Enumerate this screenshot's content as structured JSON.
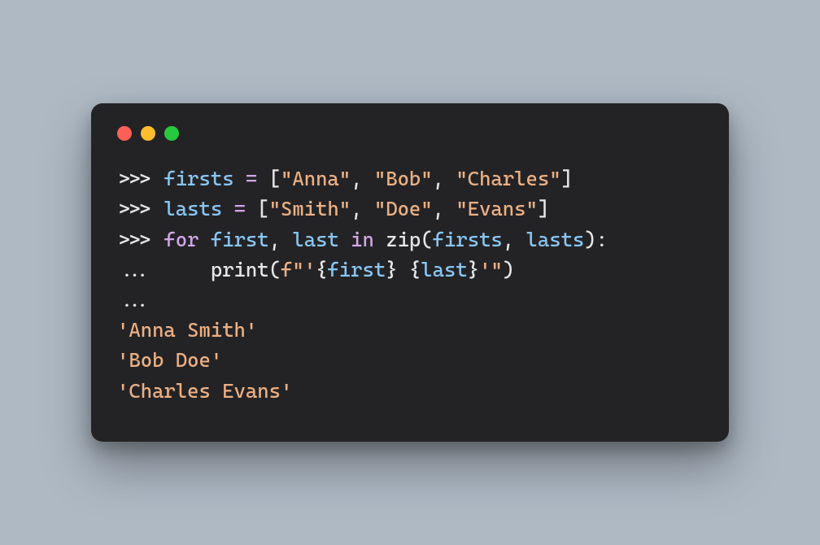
{
  "colors": {
    "background": "#aeb9c4",
    "window": "#232326",
    "dots": {
      "red": "#ff5f56",
      "yellow": "#ffbd2e",
      "green": "#27c93f"
    }
  },
  "code": {
    "lines": [
      [
        {
          "t": ">>> ",
          "c": "default"
        },
        {
          "t": "firsts",
          "c": "var"
        },
        {
          "t": " ",
          "c": "default"
        },
        {
          "t": "=",
          "c": "op"
        },
        {
          "t": " [",
          "c": "punct"
        },
        {
          "t": "\"Anna\"",
          "c": "str"
        },
        {
          "t": ", ",
          "c": "punct"
        },
        {
          "t": "\"Bob\"",
          "c": "str"
        },
        {
          "t": ", ",
          "c": "punct"
        },
        {
          "t": "\"Charles\"",
          "c": "str"
        },
        {
          "t": "]",
          "c": "punct"
        }
      ],
      [
        {
          "t": ">>> ",
          "c": "default"
        },
        {
          "t": "lasts",
          "c": "var"
        },
        {
          "t": " ",
          "c": "default"
        },
        {
          "t": "=",
          "c": "op"
        },
        {
          "t": " [",
          "c": "punct"
        },
        {
          "t": "\"Smith\"",
          "c": "str"
        },
        {
          "t": ", ",
          "c": "punct"
        },
        {
          "t": "\"Doe\"",
          "c": "str"
        },
        {
          "t": ", ",
          "c": "punct"
        },
        {
          "t": "\"Evans\"",
          "c": "str"
        },
        {
          "t": "]",
          "c": "punct"
        }
      ],
      [
        {
          "t": ">>> ",
          "c": "default"
        },
        {
          "t": "for",
          "c": "kw"
        },
        {
          "t": " ",
          "c": "default"
        },
        {
          "t": "first",
          "c": "var"
        },
        {
          "t": ", ",
          "c": "punct"
        },
        {
          "t": "last",
          "c": "var"
        },
        {
          "t": " ",
          "c": "default"
        },
        {
          "t": "in",
          "c": "kw"
        },
        {
          "t": " zip(",
          "c": "punct"
        },
        {
          "t": "firsts",
          "c": "var"
        },
        {
          "t": ", ",
          "c": "punct"
        },
        {
          "t": "lasts",
          "c": "var"
        },
        {
          "t": "):",
          "c": "punct"
        }
      ],
      [
        {
          "t": "...     print(",
          "c": "punct"
        },
        {
          "t": "f\"'",
          "c": "str"
        },
        {
          "t": "{",
          "c": "fstrbr"
        },
        {
          "t": "first",
          "c": "var"
        },
        {
          "t": "}",
          "c": "fstrbr"
        },
        {
          "t": " ",
          "c": "str"
        },
        {
          "t": "{",
          "c": "fstrbr"
        },
        {
          "t": "last",
          "c": "var"
        },
        {
          "t": "}",
          "c": "fstrbr"
        },
        {
          "t": "'\"",
          "c": "str"
        },
        {
          "t": ")",
          "c": "punct"
        }
      ],
      [
        {
          "t": "...",
          "c": "default"
        }
      ],
      [
        {
          "t": "'Anna Smith'",
          "c": "str"
        }
      ],
      [
        {
          "t": "'Bob Doe'",
          "c": "str"
        }
      ],
      [
        {
          "t": "'Charles Evans'",
          "c": "str"
        }
      ]
    ]
  }
}
